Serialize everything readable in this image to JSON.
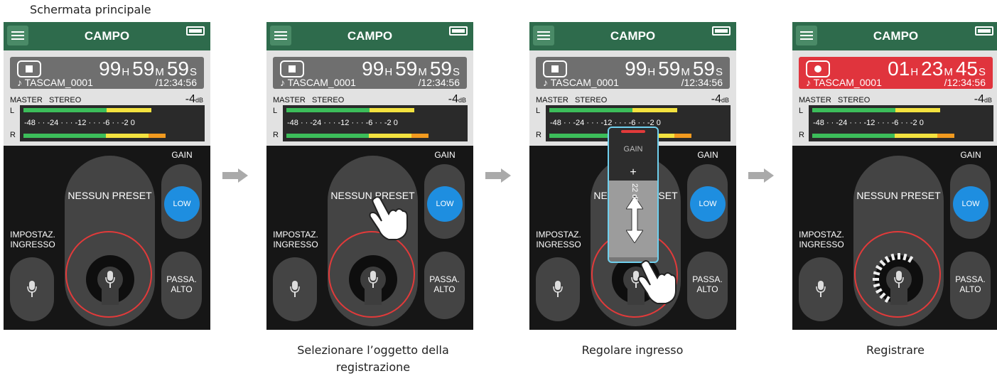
{
  "top_caption": "Schermata principale",
  "screens": [
    {
      "title": "CAMPO",
      "time_h": "99",
      "unit_h": "H",
      "time_m": "59",
      "unit_m": "M",
      "time_s": "59",
      "unit_s": "S",
      "file": "♪ TASCAM_0001",
      "total": "/12:34:56",
      "master": "MASTER",
      "stereo": "STEREO",
      "level": "-4",
      "level_unit": "dB",
      "ch_l": "L",
      "ch_r": "R",
      "scale": "-48 · · -24 · · · -12 · · · -6 · · -2 0",
      "preset": "NESSUN PRESET",
      "gain_label": "GAIN",
      "gain_value": "LOW",
      "input_label_1": "IMPOSTAZ.",
      "input_label_2": "INGRESSO",
      "highpass_1": "PASSA.",
      "highpass_2": "ALTO"
    },
    {
      "title": "CAMPO",
      "time_h": "99",
      "unit_h": "H",
      "time_m": "59",
      "unit_m": "M",
      "time_s": "59",
      "unit_s": "S",
      "file": "♪ TASCAM_0001",
      "total": "/12:34:56",
      "master": "MASTER",
      "stereo": "STEREO",
      "level": "-4",
      "level_unit": "dB",
      "ch_l": "L",
      "ch_r": "R",
      "scale": "-48 · · -24 · · · -12 · · · -6 · · -2 0",
      "preset": "NESSUN PRESET",
      "gain_label": "GAIN",
      "gain_value": "LOW",
      "input_label_1": "IMPOSTAZ.",
      "input_label_2": "INGRESSO",
      "highpass_1": "PASSA.",
      "highpass_2": "ALTO"
    },
    {
      "title": "CAMPO",
      "time_h": "99",
      "unit_h": "H",
      "time_m": "59",
      "unit_m": "M",
      "time_s": "59",
      "unit_s": "S",
      "file": "♪ TASCAM_0001",
      "total": "/12:34:56",
      "master": "MASTER",
      "stereo": "STEREO",
      "level": "-4",
      "level_unit": "dB",
      "ch_l": "L",
      "ch_r": "R",
      "scale": "-48 · · -24 · · · -12 · · · -6 · · -2 0",
      "preset": "NESSUN PRESET",
      "gain_label": "GAIN",
      "gain_value": "LOW",
      "input_label_1": "IMPOSTAZ.",
      "input_label_2": "INGRESSO",
      "highpass_1": "PASSA.",
      "highpass_2": "ALTO",
      "popup_label": "GAIN",
      "popup_plus": "+",
      "popup_value": "22 dB"
    },
    {
      "title": "CAMPO",
      "time_h": "01",
      "unit_h": "H",
      "time_m": "23",
      "unit_m": "M",
      "time_s": "45",
      "unit_s": "S",
      "file": "♪ TASCAM_0001",
      "total": "/12:34:56",
      "master": "MASTER",
      "stereo": "STEREO",
      "level": "-4",
      "level_unit": "dB",
      "ch_l": "L",
      "ch_r": "R",
      "scale": "-48 · · -24 · · · -12 · · · -6 · · -2 0",
      "preset": "NESSUN PRESET",
      "gain_label": "GAIN",
      "gain_value": "LOW",
      "input_label_1": "IMPOSTAZ.",
      "input_label_2": "INGRESSO",
      "highpass_1": "PASSA.",
      "highpass_2": "ALTO"
    }
  ],
  "captions": {
    "step2_line1": "Selezionare l’oggetto della",
    "step2_line2": "registrazione",
    "step3": "Regolare ingresso",
    "step4": "Registrare"
  },
  "colors": {
    "titlebar": "#2e6b4c",
    "record": "#e0343d",
    "gain_low": "#1e8ee0",
    "ring": "#e23a3a"
  }
}
